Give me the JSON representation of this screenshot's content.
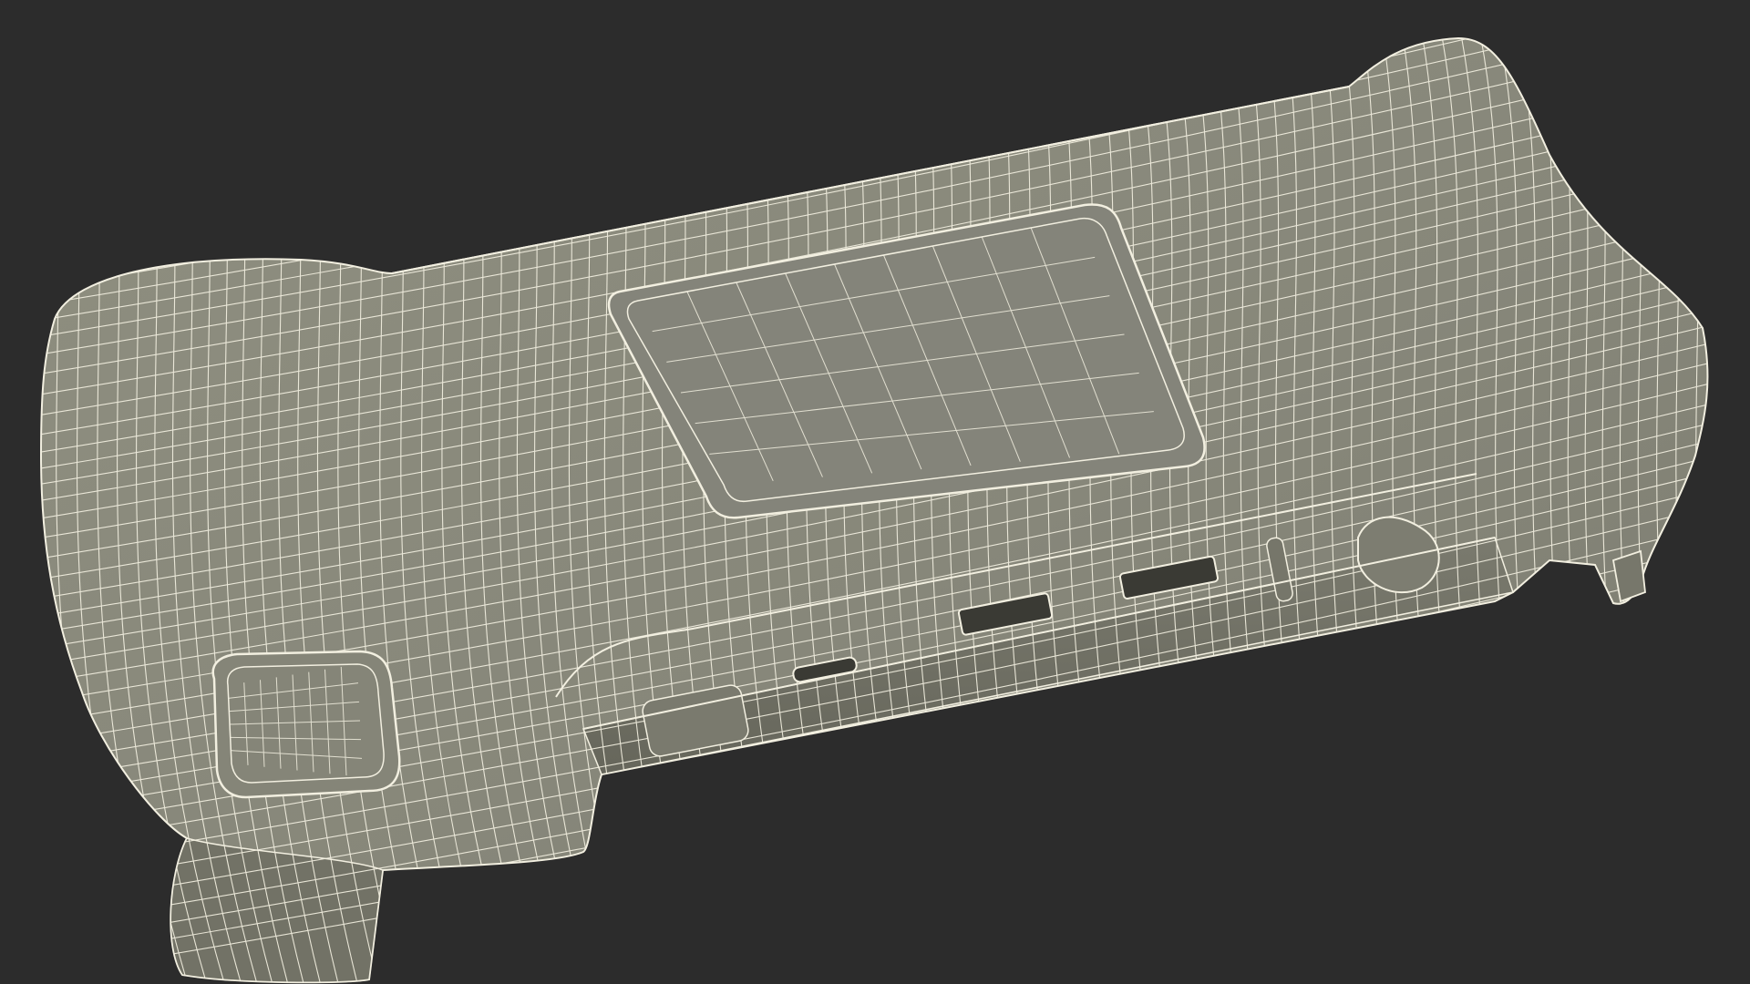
{
  "scene": {
    "description_free": true,
    "colors": {
      "background": "#2c2c2c",
      "shell_fill": "#8a8a7b",
      "shell_shadow": "#6f6f63",
      "shell_light": "#9a9a8a",
      "wire": "#f2efe0",
      "port": "#3a3a34"
    }
  }
}
